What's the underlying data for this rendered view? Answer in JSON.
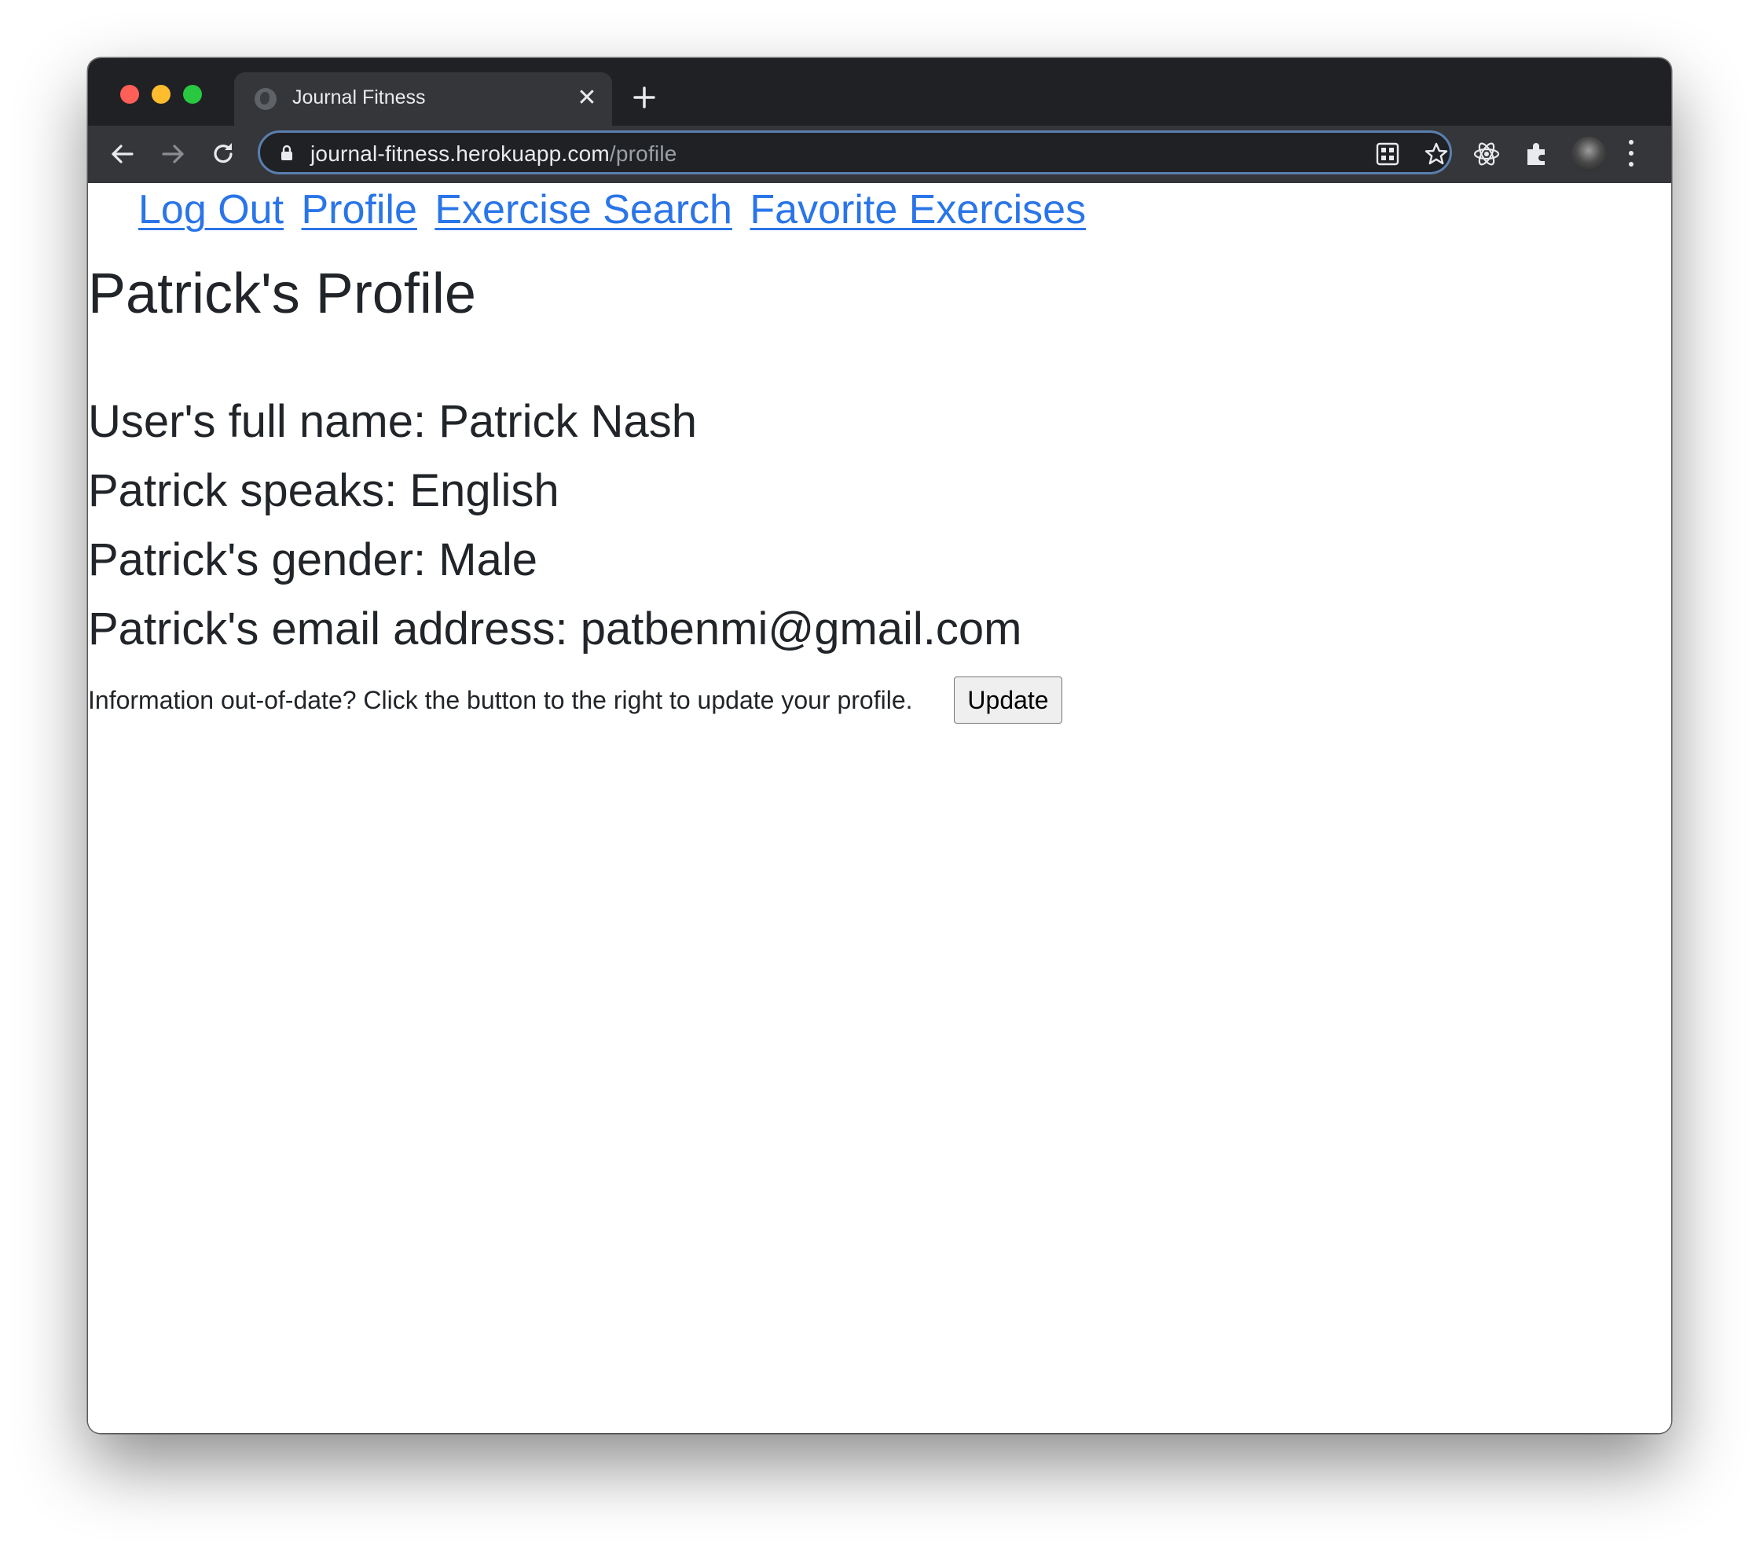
{
  "browser": {
    "tab_title": "Journal Fitness",
    "tab_close_glyph": "✕",
    "url_host": "journal-fitness.herokuapp.com",
    "url_path": "/profile",
    "omnibox_border_color": "#5a7fb0",
    "chrome_dark_color": "#202124",
    "toolbar_color": "#35363a",
    "icons": [
      "back-arrow-icon",
      "forward-arrow-icon",
      "reload-icon",
      "lock-icon",
      "qr-code-icon",
      "bookmark-star-icon",
      "react-devtools-icon",
      "extensions-puzzle-icon",
      "profile-avatar",
      "more-menu-icon",
      "new-tab-plus-icon",
      "tab-favicon-globe-icon"
    ]
  },
  "nav": {
    "links": [
      {
        "label": "Log Out"
      },
      {
        "label": "Profile"
      },
      {
        "label": "Exercise Search"
      },
      {
        "label": "Favorite Exercises"
      }
    ],
    "link_color": "#2a75e8"
  },
  "profile": {
    "title": "Patrick's Profile",
    "full_name_line": "User's full name: Patrick Nash",
    "language_line": "Patrick speaks: English",
    "gender_line": "Patrick's gender: Male",
    "email_line": "Patrick's email address: patbenmi@gmail.com"
  },
  "update": {
    "prompt": "Information out-of-date? Click the button to the right to update your profile.",
    "button_label": "Update"
  }
}
